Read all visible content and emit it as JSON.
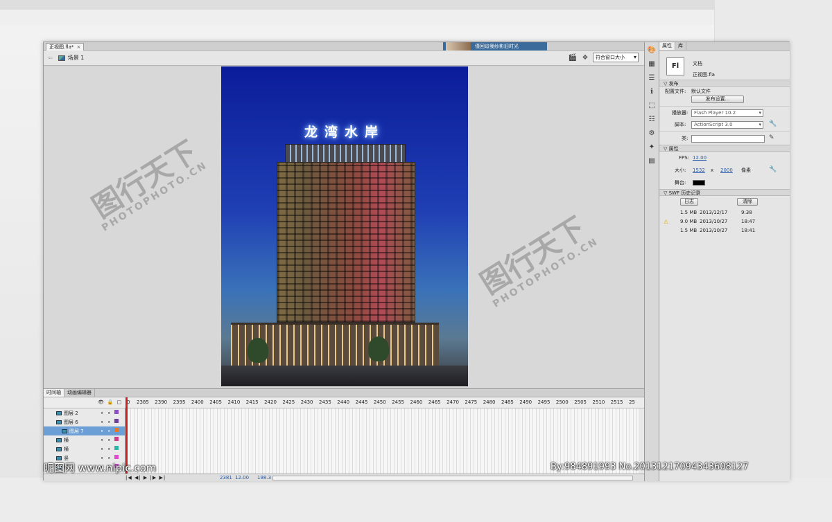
{
  "app": {
    "doc_tab": "正视图.fla*",
    "doc_tab_close": "×",
    "notification": "僅回迨我纱影旧时光",
    "back_arrow": "⇦",
    "scene_label": "场景 1",
    "zoom_value": "符合窗口大小"
  },
  "stage": {
    "sign_text": "龙湾水岸",
    "bg_colors": {
      "sky_top": "#0b1c9a",
      "sky_bottom": "#5b7a92"
    }
  },
  "watermarks": {
    "logo_text": "图行天下",
    "url_text": "PHOTOPHOTO.CN"
  },
  "timeline": {
    "tabs": [
      "时间轴",
      "动画编辑器"
    ],
    "ruler": [
      "2385",
      "2390",
      "2395",
      "2400",
      "2405",
      "2410",
      "2415",
      "2420",
      "2425",
      "2430",
      "2435",
      "2440",
      "2445",
      "2450",
      "2455",
      "2460",
      "2465",
      "2470",
      "2475",
      "2480",
      "2485",
      "2490",
      "2495",
      "2500",
      "2505",
      "2510",
      "2515",
      "25"
    ],
    "ruler_start": "0",
    "header_icons": [
      "👁",
      "🔒",
      "□"
    ],
    "layers": [
      {
        "name": "图层 2",
        "swatch": "#8a4fc8",
        "selected": false
      },
      {
        "name": "图层 6",
        "swatch": "#6b3fa0",
        "selected": false
      },
      {
        "name": "图层 7",
        "swatch": "#e07a2c",
        "selected": true
      },
      {
        "name": "横",
        "swatch": "#d43a8a",
        "selected": false
      },
      {
        "name": "横",
        "swatch": "#2fb4a8",
        "selected": false
      },
      {
        "name": "竖",
        "swatch": "#e04ad0",
        "selected": false
      },
      {
        "name": "层",
        "swatch": "#c84ad0",
        "selected": false
      }
    ],
    "controls": "|◀ ◀| ▶ |▶ ▶|",
    "frame_number": "2381",
    "fps": "12.00",
    "fps_unit": "fps",
    "time": "198.3"
  },
  "credits": {
    "left": "昵图网 www.nipic.com",
    "right": "By:984891993 No.20131217094343608127"
  },
  "properties": {
    "tabs": [
      "属性",
      "库"
    ],
    "fl_icon": "Fl",
    "doc_type": "文档",
    "file_name": "正视图.fla",
    "publish_section": "发布",
    "profile_label": "配置文件:",
    "profile_value": "默认文件",
    "publish_settings_button": "发布设置...",
    "player_label": "播放器:",
    "player_value": "Flash Player 10.2",
    "script_label": "脚本:",
    "script_value": "ActionScript 3.0",
    "class_label": "类:",
    "props_section": "属性",
    "fps_label": "FPS:",
    "fps_value": "12.00",
    "size_label": "大小:",
    "width": "1532",
    "size_x": "x",
    "height": "2000",
    "unit": "像素",
    "stage_label": "舞台:",
    "stage_color": "#000000",
    "swf_section": "SWF 历史记录",
    "log_button": "日志",
    "clear_button": "清除",
    "history": [
      {
        "size": "1.5 MB",
        "date": "2013/12/17",
        "time": "9:38",
        "warn": false
      },
      {
        "size": "9.0 MB",
        "date": "2013/10/27",
        "time": "18:47",
        "warn": true
      },
      {
        "size": "1.5 MB",
        "date": "2013/10/27",
        "time": "18:41",
        "warn": false
      }
    ]
  }
}
